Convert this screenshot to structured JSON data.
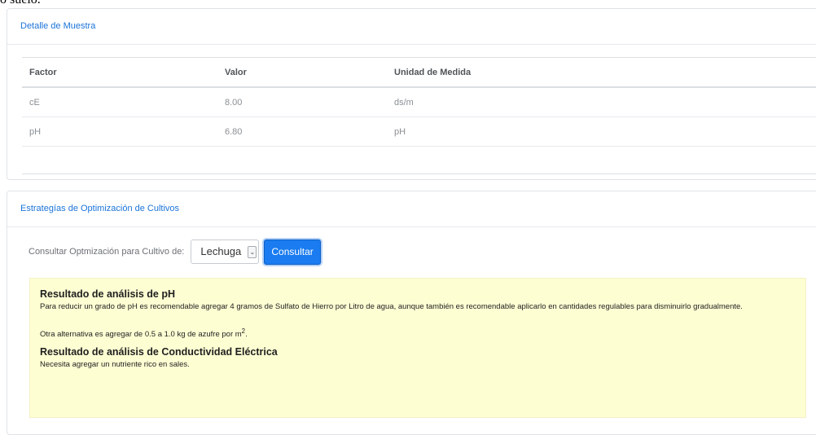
{
  "top_fragment": "o suelo.",
  "sample_detail": {
    "title": "Detalle de Muestra",
    "columns": [
      "Factor",
      "Valor",
      "Unidad de Medida"
    ],
    "rows": [
      {
        "factor": "cE",
        "valor": "8.00",
        "unidad": "ds/m"
      },
      {
        "factor": "pH",
        "valor": "6.80",
        "unidad": "pH"
      }
    ]
  },
  "optimization": {
    "title": "Estrategías de Optimización de Cultivos",
    "consult_label": "Consultar Optmización para Cultivo de:",
    "crop_selected": "Lechuga",
    "consult_button": "Consultar",
    "results": {
      "ph_title": "Resultado de análisis de pH",
      "ph_text": "Para reducir un grado de pH es recomendable agregar 4 gramos de Sulfato de Hierro por Litro de agua, aunque también es recomendable aplicarlo en cantidades regulables para disminuirlo gradualmente.",
      "ph_alt_prefix": "Otra alternativa es agregar de 0.5 a 1.0 kg de azufre por m",
      "ph_alt_sup": "2",
      "ph_alt_suffix": ".",
      "ce_title": "Resultado de análisis de Conductividad Eléctrica",
      "ce_text": "Necesita agregar un nutriente rico en sales."
    }
  }
}
